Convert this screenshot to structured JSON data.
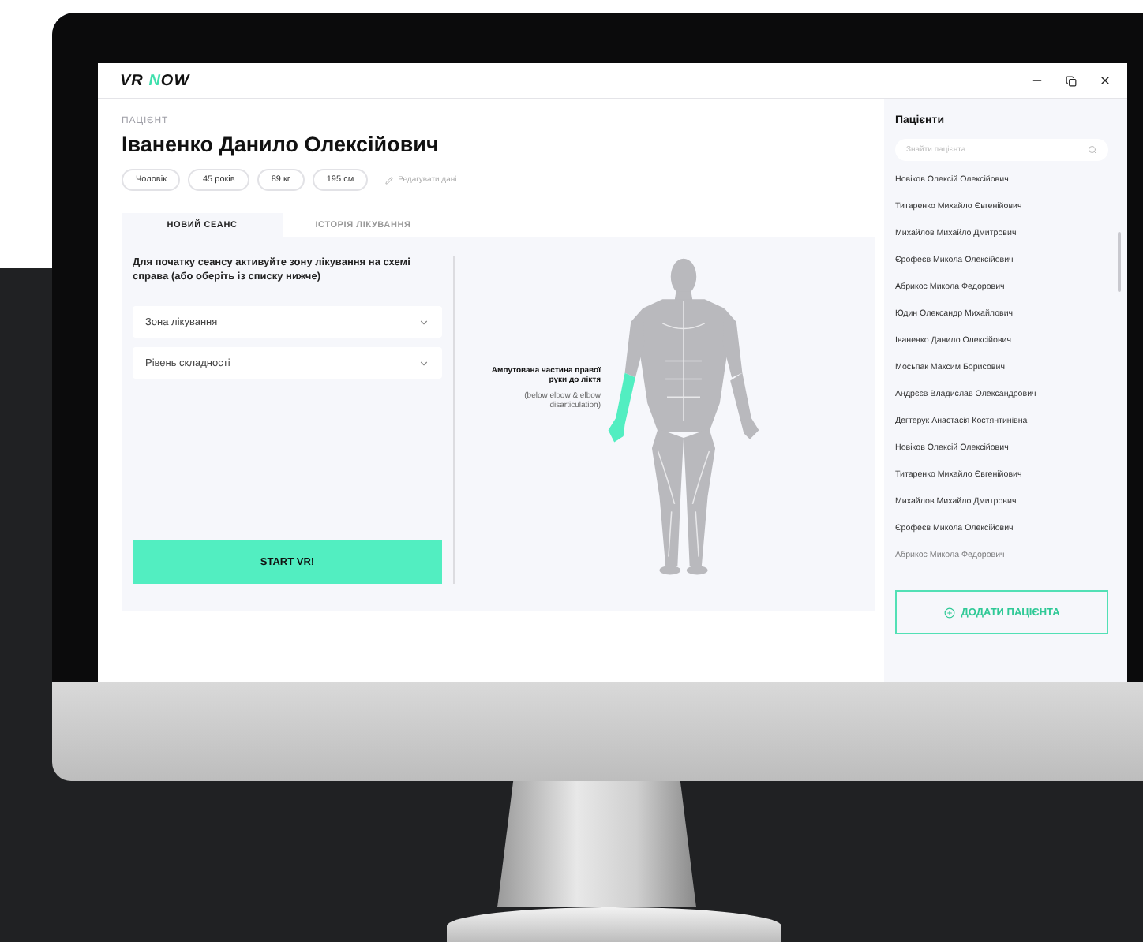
{
  "logo": {
    "lead": "VR",
    "accent": "N",
    "rest": "OW"
  },
  "patient": {
    "label": "ПАЦІЄНТ",
    "name": "Іваненко Данило Олексійович",
    "chips": [
      "Чоловік",
      "45 років",
      "89 кг",
      "195 см"
    ],
    "edit_link": "Редагувати дані"
  },
  "tabs": [
    {
      "label": "НОВИЙ СЕАНС",
      "selected": true
    },
    {
      "label": "ІСТОРІЯ ЛІКУВАННЯ",
      "selected": false
    }
  ],
  "session": {
    "instruction": "Для початку сеансу активуйте зону лікування на схемі справа (або оберіть із списку нижче)",
    "dropdowns": [
      {
        "placeholder": "Зона лікування"
      },
      {
        "placeholder": "Рівень складності"
      }
    ],
    "start_button": "START VR!"
  },
  "body_map": {
    "highlighted": true,
    "zone_title": "Ампутована частина правої руки до ліктя",
    "zone_note": "(below elbow & elbow disarticulation)"
  },
  "sidebar": {
    "title": "Пацієнти",
    "search": {
      "placeholder": "Знайти пацієнта"
    },
    "patients": [
      "Новіков Олексій Олексійович",
      "Титаренко Михайло Євгенійович",
      "Михайлов Михайло Дмитрович",
      "Єрофеєв Микола Олексійович",
      "Абрикос Микола Федорович",
      "Юдин Олександр Михайлович",
      "Іваненко Данило Олексійович",
      "Мосьпак Максим Борисович",
      "Андрєєв Владислав Олександрович",
      "Дегтерук Анастасія Костянтинівна",
      "Новіков Олексій Олексійович",
      "Титаренко Михайло Євгенійович",
      "Михайлов Михайло Дмитрович",
      "Єрофеєв Микола Олексійович",
      "Абрикос Микола Федорович"
    ],
    "add_button": "ДОДАТИ ПАЦІЄНТА"
  }
}
